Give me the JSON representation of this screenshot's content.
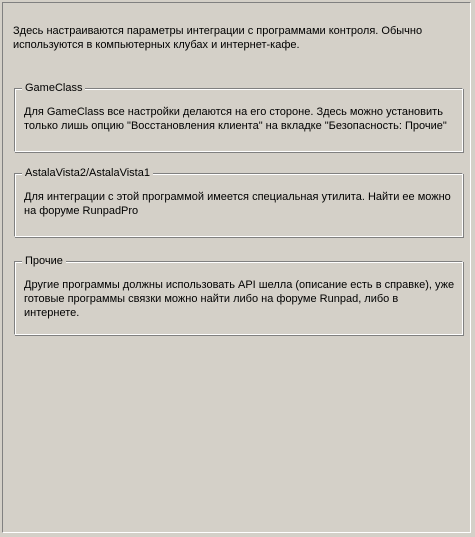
{
  "intro": "Здесь настраиваются параметры интеграции с программами контроля. Обычно\nиспользуются в компьютерных клубах и интернет-кафе.",
  "groups": [
    {
      "title": "GameClass",
      "text": "Для GameClass все настройки делаются на его стороне. Здесь можно установить\nтолько лишь опцию \"Восстановления клиента\" на вкладке \"Безопасность: Прочие\""
    },
    {
      "title": "AstalaVista2/AstalaVista1",
      "text": "Для интеграции с этой программой имеется специальная утилита. Найти ее можно\nна форуме RunpadPro"
    },
    {
      "title": "Прочие",
      "text": "Другие программы должны использовать API шелла (описание есть в справке), уже\nготовые программы связки можно найти либо на форуме Runpad, либо в\nинтернете."
    }
  ]
}
